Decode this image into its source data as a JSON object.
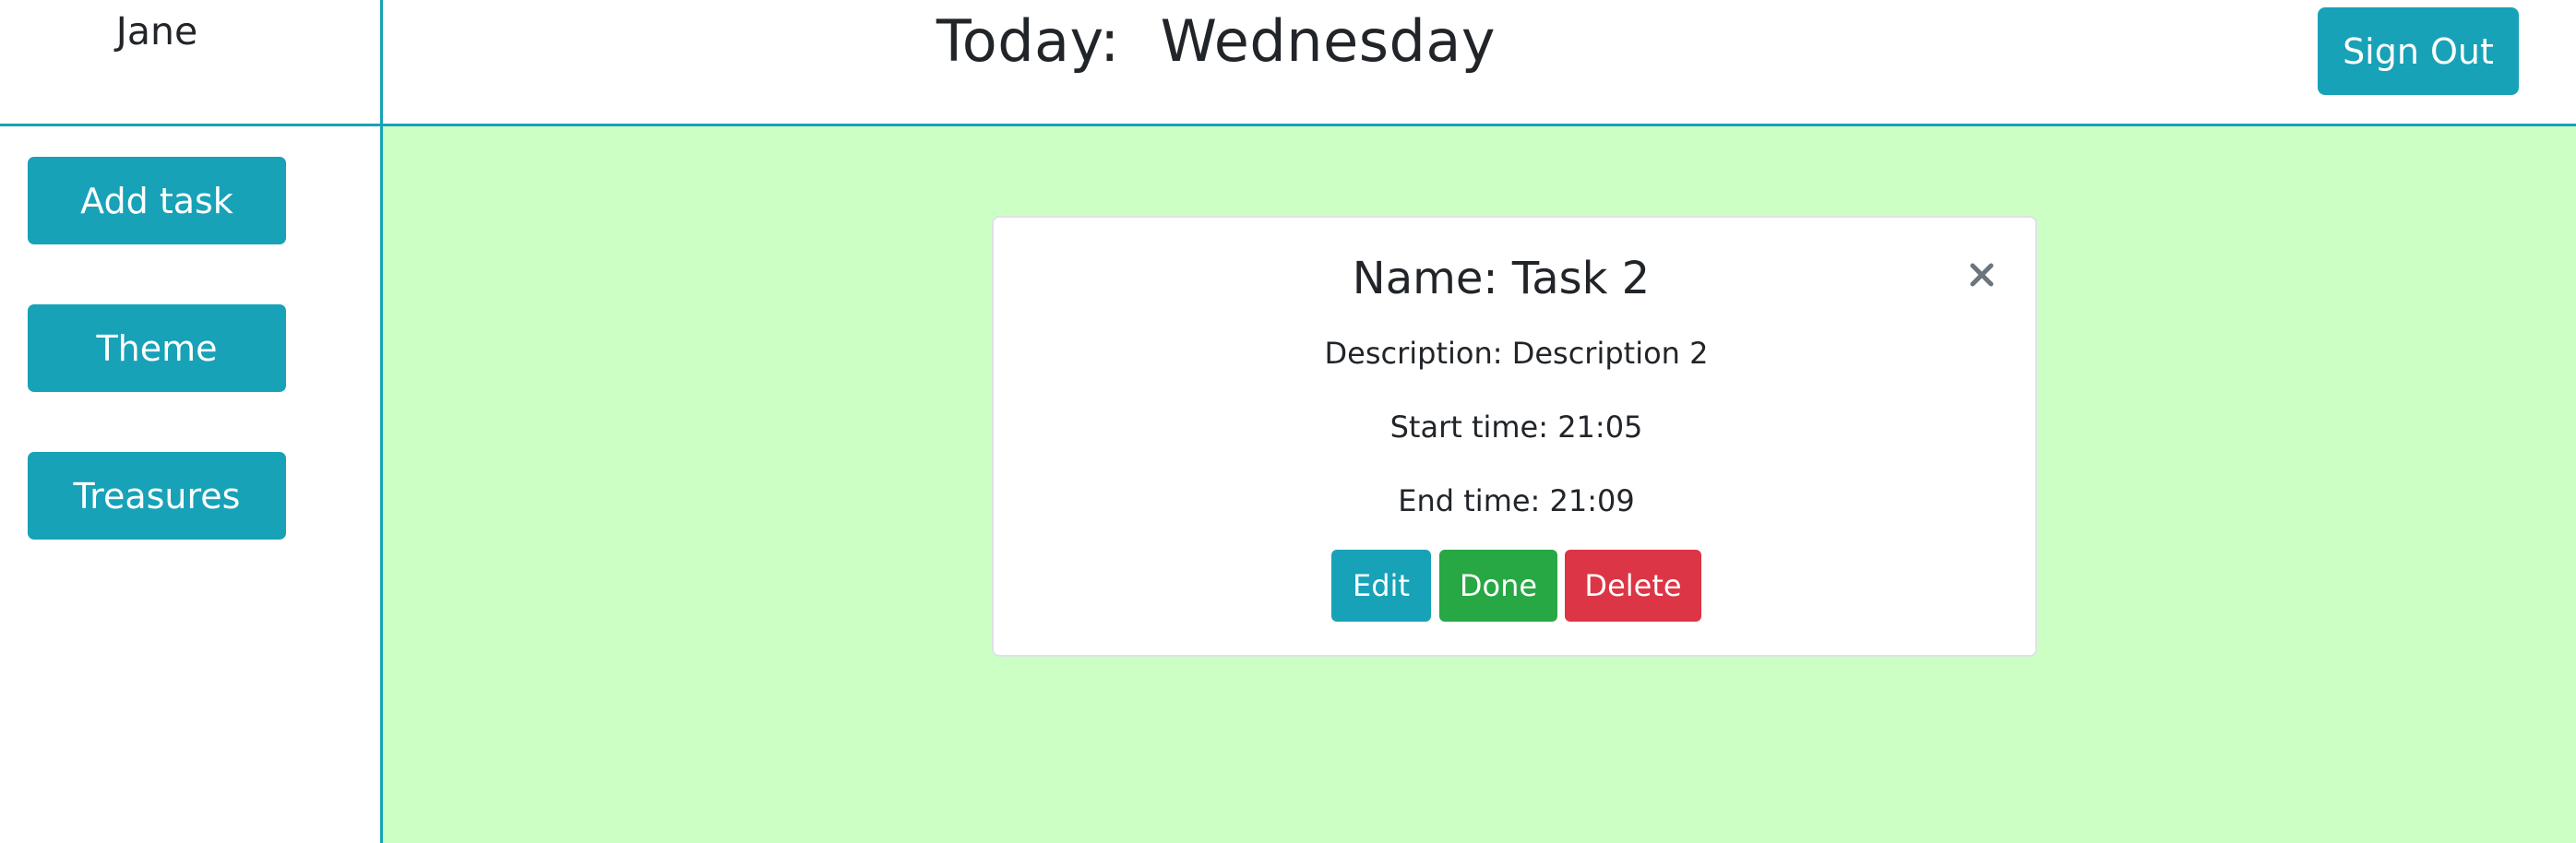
{
  "header": {
    "user_name": "Jane",
    "today_label": "Today:",
    "day": "Wednesday",
    "sign_out_label": "Sign Out"
  },
  "sidebar": {
    "items": [
      {
        "label": "Add task"
      },
      {
        "label": "Theme"
      },
      {
        "label": "Treasures"
      }
    ]
  },
  "task": {
    "title": "Name: Task 2",
    "description": "Description: Description 2",
    "start_time": "Start time: 21:05",
    "end_time": "End time: 21:09",
    "close_icon": "close-icon",
    "actions": {
      "edit_label": "Edit",
      "done_label": "Done",
      "delete_label": "Delete"
    }
  },
  "colors": {
    "accent": "#17a2b8",
    "main_background": "#ccffc4",
    "done": "#28a745",
    "delete": "#dc3545"
  }
}
